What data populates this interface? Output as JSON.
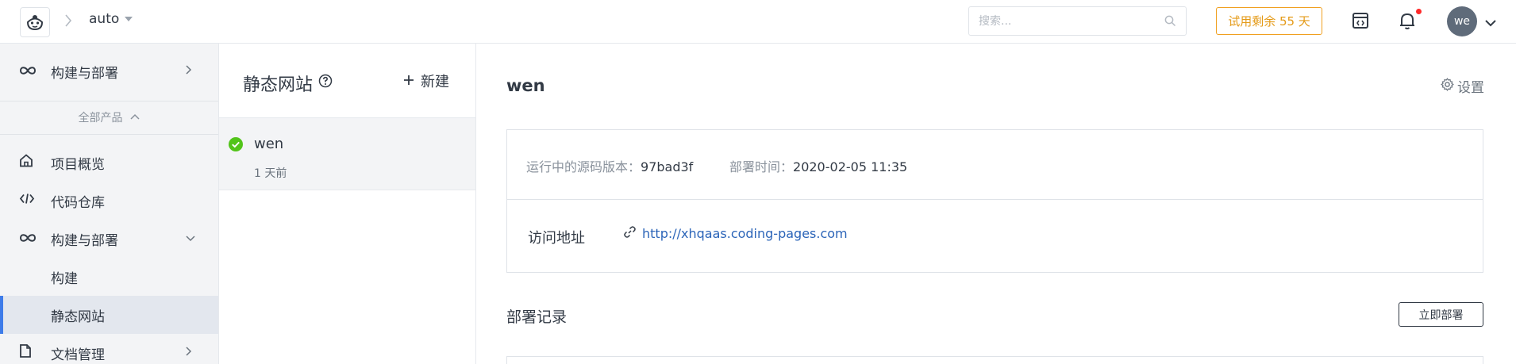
{
  "topbar": {
    "project_name": "auto",
    "search_placeholder": "搜索...",
    "trial_badge": "试用剩余 55 天",
    "avatar_initials": "we"
  },
  "sidebar": {
    "top_item": {
      "label": "构建与部署",
      "icon": "infinity-icon"
    },
    "all_products_label": "全部产品",
    "items": [
      {
        "label": "项目概览",
        "icon": "home-icon"
      },
      {
        "label": "代码仓库",
        "icon": "code-icon"
      },
      {
        "label": "构建与部署",
        "icon": "infinity-icon",
        "expanded": true
      },
      {
        "label": "构建",
        "sub": true
      },
      {
        "label": "静态网站",
        "sub": true,
        "active": true
      },
      {
        "label": "文档管理",
        "icon": "document-icon"
      }
    ]
  },
  "list": {
    "title": "静态网站",
    "new_label": "新建",
    "sites": [
      {
        "name": "wen",
        "time": "1 天前",
        "status": "success"
      }
    ]
  },
  "detail": {
    "title": "wen",
    "settings_label": "设置",
    "version_label": "运行中的源码版本：",
    "version_value": "97bad3f",
    "deploy_time_label": "部署时间：",
    "deploy_time_value": "2020-02-05 11:35",
    "access_label": "访问地址",
    "access_url": "http://xhqaas.coding-pages.com",
    "records_title": "部署记录",
    "deploy_now_label": "立即部署"
  },
  "colors": {
    "accent": "#3e7ce9",
    "trial": "#e49a17",
    "success": "#52c41a",
    "link": "#2b64b8",
    "notification_dot": "#ff2a2a"
  }
}
